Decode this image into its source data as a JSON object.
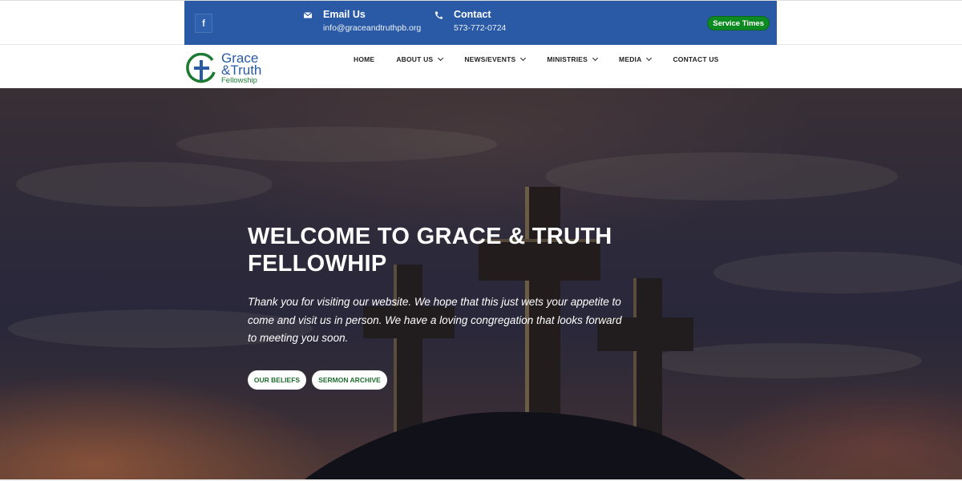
{
  "topbar": {
    "facebook_icon": "facebook-icon",
    "email": {
      "icon": "envelope-icon",
      "title": "Email Us",
      "value": "info@graceandtruthpb.org"
    },
    "phone": {
      "icon": "phone-icon",
      "title": "Contact",
      "value": "573-772-0724"
    },
    "service_times_label": "Service Times"
  },
  "logo": {
    "line1": "Grace",
    "line2": "&Truth",
    "line3": "Fellowship"
  },
  "nav": {
    "items": [
      {
        "label": "HOME"
      },
      {
        "label": "ABOUT US"
      },
      {
        "label": "NEWS/EVENTS"
      },
      {
        "label": "MINISTRIES"
      },
      {
        "label": "MEDIA"
      },
      {
        "label": "CONTACT US"
      }
    ]
  },
  "hero": {
    "title_line1": "WELCOME TO GRACE & TRUTH",
    "title_line2": "FELLOWHIP",
    "text": "Thank you for visiting our website. We hope that this just wets your appetite to come and visit us in person. We have a loving congregation that looks forward to meeting you soon.",
    "button_beliefs": "OUR BELIEFS",
    "button_archive": "SERMON ARCHIVE"
  },
  "colors": {
    "topbar_blue": "#2a5aa6",
    "service_green": "#0e8a22",
    "logo_blue": "#2a5aa6",
    "logo_green": "#1d7a32"
  }
}
